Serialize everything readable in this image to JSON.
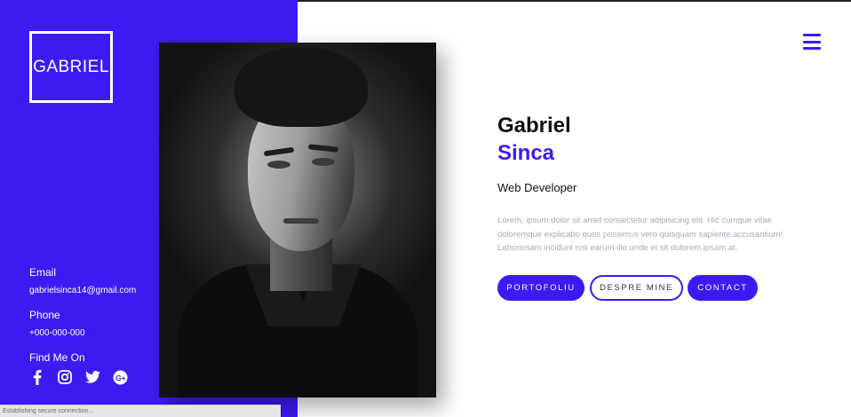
{
  "logo": {
    "text": "GABRIEL"
  },
  "contact": {
    "email_label": "Email",
    "email_value": "gabrielsinca14@gmail.com",
    "phone_label": "Phone",
    "phone_value": "+000-000-000",
    "find_label": "Find Me On",
    "socials": [
      "facebook-icon",
      "instagram-icon",
      "twitter-icon",
      "google-plus-icon"
    ]
  },
  "hero": {
    "first_name": "Gabriel",
    "last_name": "Sinca",
    "role": "Web Developer",
    "bio": "Lorem, ipsum dolor sit amet consectetur adipisicing elit. Hic cumque vitae doloremque explicabo quos possimus vero quisquam sapiente accusantium! Laboriosam incidunt nisi earum illo unde et sit dolorem ipsam at."
  },
  "buttons": {
    "portfolio": "PORTOFOLIU",
    "about": "DESPRE MINE",
    "contact": "CONTACT"
  },
  "status": {
    "text": "Establishing secure connection..."
  },
  "colors": {
    "accent": "#3c1bf3",
    "text_dark": "#111111",
    "text_muted": "#a8a8b8",
    "white": "#ffffff"
  }
}
